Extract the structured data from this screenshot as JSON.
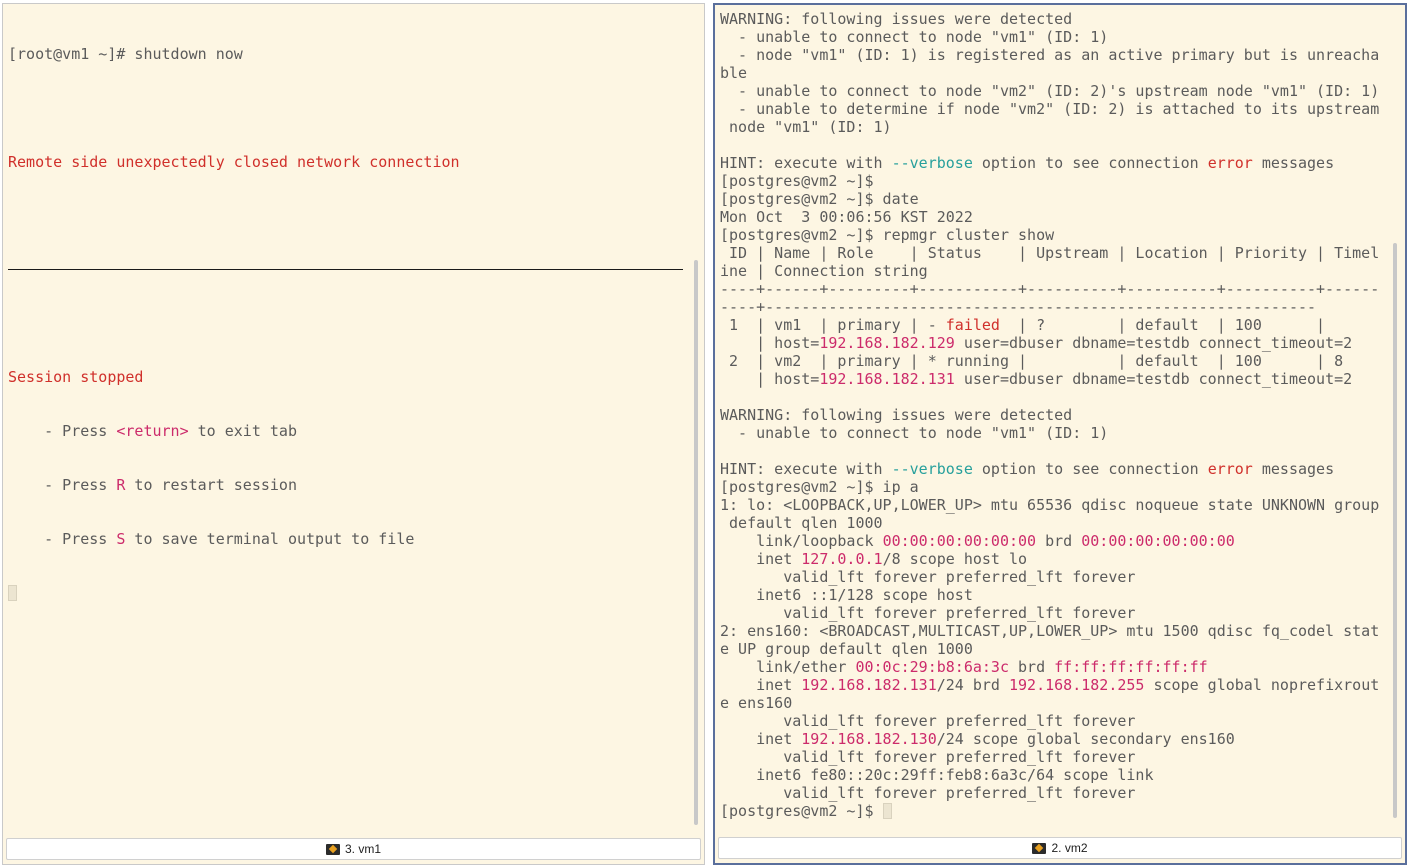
{
  "left_pane": {
    "tab_label": "3. vm1",
    "prompt_line": "[root@vm1 ~]# shutdown now",
    "error_message": "Remote side unexpectedly closed network connection",
    "session_stopped": "Session stopped",
    "hint_return": {
      "prefix": "    - Press ",
      "key": "<return>",
      "suffix": " to exit tab"
    },
    "hint_restart": {
      "prefix": "    - Press ",
      "key": "R",
      "suffix": " to restart session"
    },
    "hint_save": {
      "prefix": "    - Press ",
      "key": "S",
      "suffix": " to save terminal output to file"
    }
  },
  "right_pane": {
    "tab_label": "2. vm2",
    "lines": [
      [
        [
          "WARNING: following issues were detected",
          ""
        ]
      ],
      [
        [
          "  - unable to connect to node \"vm1\" (ID: 1)",
          ""
        ]
      ],
      [
        [
          "  - node \"vm1\" (ID: 1) is registered as an active primary but is unreacha",
          ""
        ]
      ],
      [
        [
          "ble",
          ""
        ]
      ],
      [
        [
          "  - unable to connect to node \"vm2\" (ID: 2)'s upstream node \"vm1\" (ID: 1)",
          ""
        ]
      ],
      [
        [
          "  - unable to determine if node \"vm2\" (ID: 2) is attached to its upstream",
          ""
        ]
      ],
      [
        [
          " node \"vm1\" (ID: 1)",
          ""
        ]
      ],
      [
        [
          "",
          ""
        ]
      ],
      [
        [
          "HINT: execute with ",
          ""
        ],
        [
          "--verbose",
          "teal"
        ],
        [
          " option to see connection ",
          ""
        ],
        [
          "error",
          "red"
        ],
        [
          " messages",
          ""
        ]
      ],
      [
        [
          "[postgres@vm2 ~]$",
          ""
        ]
      ],
      [
        [
          "[postgres@vm2 ~]$ date",
          ""
        ]
      ],
      [
        [
          "Mon Oct  3 00:06:56 KST 2022",
          ""
        ]
      ],
      [
        [
          "[postgres@vm2 ~]$ repmgr cluster show",
          ""
        ]
      ],
      [
        [
          " ID | Name | Role    | Status    | Upstream | Location | Priority | Timel",
          ""
        ]
      ],
      [
        [
          "ine | Connection string",
          ""
        ]
      ],
      [
        [
          "----+------+---------+-----------+----------+----------+----------+------",
          ""
        ]
      ],
      [
        [
          "----+-------------------------------------------------------------",
          ""
        ]
      ],
      [
        [
          " 1  | vm1  | primary | - ",
          ""
        ],
        [
          "failed",
          "red"
        ],
        [
          "  | ?        | default  | 100      |",
          ""
        ]
      ],
      [
        [
          "    | host=",
          ""
        ],
        [
          "192.168.182.129",
          "mag"
        ],
        [
          " user=dbuser dbname=testdb connect_timeout=2",
          ""
        ]
      ],
      [
        [
          " 2  | vm2  | primary | * running |          | default  | 100      | 8",
          ""
        ]
      ],
      [
        [
          "    | host=",
          ""
        ],
        [
          "192.168.182.131",
          "mag"
        ],
        [
          " user=dbuser dbname=testdb connect_timeout=2",
          ""
        ]
      ],
      [
        [
          "",
          ""
        ]
      ],
      [
        [
          "WARNING: following issues were detected",
          ""
        ]
      ],
      [
        [
          "  - unable to connect to node \"vm1\" (ID: 1)",
          ""
        ]
      ],
      [
        [
          "",
          ""
        ]
      ],
      [
        [
          "HINT: execute with ",
          ""
        ],
        [
          "--verbose",
          "teal"
        ],
        [
          " option to see connection ",
          ""
        ],
        [
          "error",
          "red"
        ],
        [
          " messages",
          ""
        ]
      ],
      [
        [
          "[postgres@vm2 ~]$ ip a",
          ""
        ]
      ],
      [
        [
          "1: lo: <LOOPBACK,UP,LOWER_UP> mtu 65536 qdisc noqueue state UNKNOWN group",
          ""
        ]
      ],
      [
        [
          " default qlen 1000",
          ""
        ]
      ],
      [
        [
          "    link/loopback ",
          ""
        ],
        [
          "00:00:00:00:00:00",
          "mag"
        ],
        [
          " brd ",
          ""
        ],
        [
          "00:00:00:00:00:00",
          "mag"
        ]
      ],
      [
        [
          "    inet ",
          ""
        ],
        [
          "127.0.0.1",
          "mag"
        ],
        [
          "/8 scope host lo",
          ""
        ]
      ],
      [
        [
          "       valid_lft forever preferred_lft forever",
          ""
        ]
      ],
      [
        [
          "    inet6 ::1/128 scope host",
          ""
        ]
      ],
      [
        [
          "       valid_lft forever preferred_lft forever",
          ""
        ]
      ],
      [
        [
          "2: ens160: <BROADCAST,MULTICAST,UP,LOWER_UP> mtu 1500 qdisc fq_codel stat",
          ""
        ]
      ],
      [
        [
          "e UP group default qlen 1000",
          ""
        ]
      ],
      [
        [
          "    link/ether ",
          ""
        ],
        [
          "00:0c:29:b8:6a:3c",
          "mag"
        ],
        [
          " brd ",
          ""
        ],
        [
          "ff:ff:ff:ff:ff:ff",
          "mag"
        ]
      ],
      [
        [
          "    inet ",
          ""
        ],
        [
          "192.168.182.131",
          "mag"
        ],
        [
          "/24 brd ",
          ""
        ],
        [
          "192.168.182.255",
          "mag"
        ],
        [
          " scope global noprefixrout",
          ""
        ]
      ],
      [
        [
          "e ens160",
          ""
        ]
      ],
      [
        [
          "       valid_lft forever preferred_lft forever",
          ""
        ]
      ],
      [
        [
          "    inet ",
          ""
        ],
        [
          "192.168.182.130",
          "mag"
        ],
        [
          "/24 scope global secondary ens160",
          ""
        ]
      ],
      [
        [
          "       valid_lft forever preferred_lft forever",
          ""
        ]
      ],
      [
        [
          "    inet6 fe80::20c:29ff:feb8:6a3c/64 scope link",
          ""
        ]
      ],
      [
        [
          "       valid_lft forever preferred_lft forever",
          ""
        ]
      ],
      [
        [
          "[postgres@vm2 ~]$ ",
          ""
        ]
      ]
    ]
  },
  "colors": {
    "terminal_bg": "#fdf6e3",
    "text": "#5b5b5b",
    "red": "#d0302b",
    "magenta": "#cc2b6b",
    "teal": "#27a09c",
    "active_border": "#5a6f9c"
  },
  "icons": {
    "tab_icon": "putty-terminal-icon"
  }
}
